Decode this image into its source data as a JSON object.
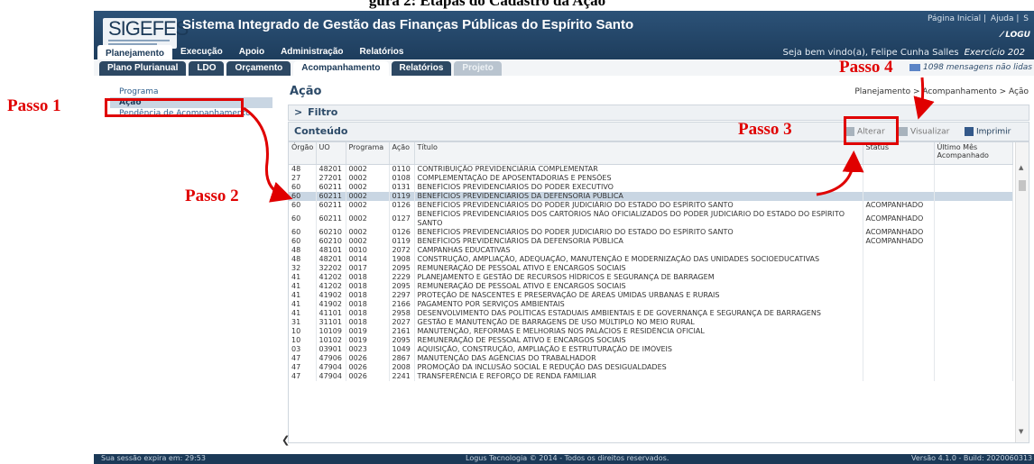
{
  "caption": "gura 2: Etapas do Cadastro da Ação",
  "header": {
    "logo_text": "SIGEFES",
    "app_title": "Sistema Integrado de Gestão das Finanças Públicas do Espírito Santo",
    "top_links": [
      "Página Inicial",
      "Ajuda",
      "S"
    ],
    "brand": "LOGU",
    "welcome": "Seja bem vindo(a), Felipe Cunha Salles",
    "exercicio": "Exercício 202"
  },
  "main_menu": [
    "Planejamento",
    "Execução",
    "Apoio",
    "Administração",
    "Relatórios"
  ],
  "sub_menu": [
    "Plano Plurianual",
    "LDO",
    "Orçamento",
    "Acompanhamento",
    "Relatórios",
    "Projeto"
  ],
  "messages": "1098 mensagens não lidas",
  "sidebar": [
    "Programa",
    "Ação",
    "Pendência de Acompanhamento"
  ],
  "page": {
    "title": "Ação",
    "breadcrumb": "Planejamento > Acompanhamento > Ação",
    "filter_label": "Filtro",
    "content_label": "Conteúdo"
  },
  "toolbar": {
    "alterar": "Alterar",
    "visualizar": "Visualizar",
    "imprimir": "Imprimir"
  },
  "table": {
    "columns": [
      "Órgão",
      "UO",
      "Programa",
      "Ação",
      "Título",
      "Status",
      "Último Mês Acompanhado"
    ],
    "rows": [
      [
        "48",
        "48201",
        "0002",
        "0110",
        "CONTRIBUIÇÃO PREVIDENCIÁRIA COMPLEMENTAR",
        "",
        ""
      ],
      [
        "27",
        "27201",
        "0002",
        "0108",
        "COMPLEMENTAÇÃO DE APOSENTADORIAS E PENSÕES",
        "",
        ""
      ],
      [
        "60",
        "60211",
        "0002",
        "0131",
        "BENEFÍCIOS PREVIDENCIÁRIOS DO PODER EXECUTIVO",
        "",
        ""
      ],
      [
        "60",
        "60211",
        "0002",
        "0119",
        "BENEFÍCIOS PREVIDENCIÁRIOS DA DEFENSORIA PÚBLICA",
        "",
        ""
      ],
      [
        "60",
        "60211",
        "0002",
        "0126",
        "BENEFÍCIOS PREVIDENCIÁRIOS DO PODER JUDICIÁRIO DO ESTADO DO ESPÍRITO SANTO",
        "ACOMPANHADO",
        ""
      ],
      [
        "60",
        "60211",
        "0002",
        "0127",
        "BENEFÍCIOS PREVIDENCIÁRIOS DOS CARTÓRIOS NÃO OFICIALIZADOS DO PODER JUDICIÁRIO DO ESTADO DO ESPÍRITO SANTO",
        "ACOMPANHADO",
        ""
      ],
      [
        "60",
        "60210",
        "0002",
        "0126",
        "BENEFÍCIOS PREVIDENCIÁRIOS DO PODER JUDICIÁRIO DO ESTADO DO ESPÍRITO SANTO",
        "ACOMPANHADO",
        ""
      ],
      [
        "60",
        "60210",
        "0002",
        "0119",
        "BENEFÍCIOS PREVIDENCIÁRIOS DA DEFENSORIA PÚBLICA",
        "ACOMPANHADO",
        ""
      ],
      [
        "48",
        "48101",
        "0010",
        "2072",
        "CAMPANHAS EDUCATIVAS",
        "",
        ""
      ],
      [
        "48",
        "48201",
        "0014",
        "1908",
        "CONSTRUÇÃO, AMPLIAÇÃO, ADEQUAÇÃO, MANUTENÇÃO E MODERNIZAÇÃO DAS UNIDADES SOCIOEDUCATIVAS",
        "",
        ""
      ],
      [
        "32",
        "32202",
        "0017",
        "2095",
        "REMUNERAÇÃO DE PESSOAL ATIVO E ENCARGOS SOCIAIS",
        "",
        ""
      ],
      [
        "41",
        "41202",
        "0018",
        "2229",
        "PLANEJAMENTO E GESTÃO DE RECURSOS HÍDRICOS E SEGURANÇA DE BARRAGEM",
        "",
        ""
      ],
      [
        "41",
        "41202",
        "0018",
        "2095",
        "REMUNERAÇÃO DE PESSOAL ATIVO E ENCARGOS SOCIAIS",
        "",
        ""
      ],
      [
        "41",
        "41902",
        "0018",
        "2297",
        "PROTEÇÃO DE NASCENTES E PRESERVAÇÃO DE ÁREAS ÚMIDAS URBANAS E RURAIS",
        "",
        ""
      ],
      [
        "41",
        "41902",
        "0018",
        "2166",
        "PAGAMENTO POR SERVIÇOS AMBIENTAIS",
        "",
        ""
      ],
      [
        "41",
        "41101",
        "0018",
        "2958",
        "DESENVOLVIMENTO DAS POLÍTICAS ESTADUAIS AMBIENTAIS E DE GOVERNANÇA E SEGURANÇA DE BARRAGENS",
        "",
        ""
      ],
      [
        "31",
        "31101",
        "0018",
        "2027",
        "GESTÃO E MANUTENÇÃO DE BARRAGENS DE USO MÚLTIPLO NO MEIO RURAL",
        "",
        ""
      ],
      [
        "10",
        "10109",
        "0019",
        "2161",
        "MANUTENÇÃO, REFORMAS E MELHORIAS NOS PALÁCIOS E RESIDÊNCIA OFICIAL",
        "",
        ""
      ],
      [
        "10",
        "10102",
        "0019",
        "2095",
        "REMUNERAÇÃO DE PESSOAL ATIVO E ENCARGOS SOCIAIS",
        "",
        ""
      ],
      [
        "03",
        "03901",
        "0023",
        "1049",
        "AQUISIÇÃO, CONSTRUÇÃO, AMPLIAÇÃO E ESTRUTURAÇÃO DE IMÓVEIS",
        "",
        ""
      ],
      [
        "47",
        "47906",
        "0026",
        "2867",
        "MANUTENÇÃO DAS AGÊNCIAS DO TRABALHADOR",
        "",
        ""
      ],
      [
        "47",
        "47904",
        "0026",
        "2008",
        "PROMOÇÃO DA INCLUSÃO SOCIAL E REDUÇÃO DAS DESIGUALDADES",
        "",
        ""
      ],
      [
        "47",
        "47904",
        "0026",
        "2241",
        "TRANSFERÊNCIA E REFORÇO DE RENDA FAMILIAR",
        "",
        ""
      ]
    ],
    "selected_row": 3
  },
  "footer": {
    "session": "Sua sessão expira em: 29:53",
    "copyright": "Logus Tecnologia © 2014 - Todos os direitos reservados.",
    "version": "Versão 4.1.0 - Build: 2020060313"
  },
  "annotations": {
    "passo1": "Passo 1",
    "passo2": "Passo 2",
    "passo3": "Passo 3",
    "passo4": "Passo 4",
    "color": "#e00000"
  }
}
